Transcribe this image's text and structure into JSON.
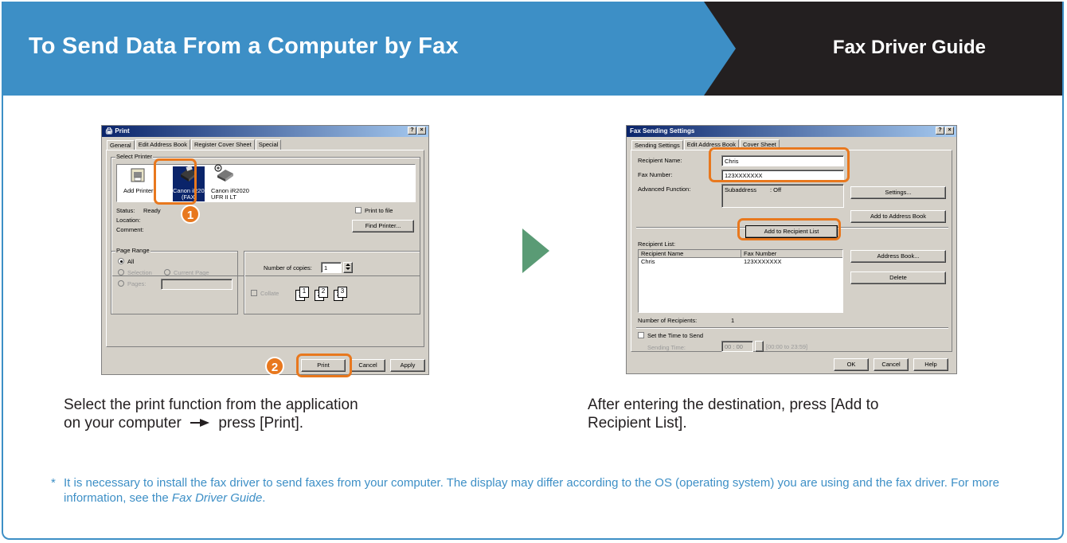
{
  "header": {
    "title": "To Send Data From a Computer by Fax",
    "guide": "Fax Driver Guide"
  },
  "colors": {
    "accent_blue": "#3d8fc6",
    "dark": "#231f20",
    "highlight_orange": "#e8781e",
    "arrow_green": "#5a9b75"
  },
  "print_dialog": {
    "title": "Print",
    "help_btn": "?",
    "close_btn": "×",
    "tabs": [
      "General",
      "Edit Address Book",
      "Register Cover Sheet",
      "Special"
    ],
    "select_printer_label": "Select Printer",
    "printers": [
      {
        "name": "Add Printer",
        "icon": "add-printer-icon"
      },
      {
        "name_line1": "Canon iR2020",
        "name_line2": "(FAX)",
        "icon": "fax-printer-icon"
      },
      {
        "name_line1": "Canon iR2020",
        "name_line2": "UFR II LT",
        "icon": "printer-icon"
      }
    ],
    "status_label": "Status:",
    "status_value": "Ready",
    "location_label": "Location:",
    "comment_label": "Comment:",
    "print_to_file": "Print to file",
    "find_printer": "Find Printer...",
    "page_range_label": "Page Range",
    "range_all": "All",
    "range_selection": "Selection",
    "range_current": "Current Page",
    "range_pages": "Pages:",
    "copies_label": "Number of copies:",
    "copies_value": "1",
    "collate": "Collate",
    "collate_icons": [
      "1",
      "1",
      "2",
      "2",
      "3",
      "3"
    ],
    "print_btn": "Print",
    "cancel_btn": "Cancel",
    "apply_btn": "Apply",
    "step1": "1",
    "step2": "2"
  },
  "fax_dialog": {
    "title": "Fax Sending Settings",
    "help_btn": "?",
    "close_btn": "×",
    "tabs": [
      "Sending Settings",
      "Edit Address Book",
      "Cover Sheet"
    ],
    "recipient_name_label": "Recipient Name:",
    "recipient_name_value": "Chris",
    "fax_number_label": "Fax Number:",
    "fax_number_value": "123XXXXXXX",
    "advanced_label": "Advanced Function:",
    "advanced_col1": "Subaddress",
    "advanced_col2": ": Off",
    "settings_btn": "Settings...",
    "add_address_book_btn": "Add to Address Book",
    "add_recipient_btn": "Add to Recipient List",
    "recipient_list_label": "Recipient List:",
    "list_headers": [
      "Recipient Name",
      "Fax Number"
    ],
    "list_rows": [
      {
        "name": "Chris",
        "fax": "123XXXXXXX"
      }
    ],
    "address_book_btn": "Address Book...",
    "delete_btn": "Delete",
    "num_recipients_label": "Number of Recipients:",
    "num_recipients_value": "1",
    "set_time_label": "Set the Time to Send",
    "sending_time_label": "Sending Time:",
    "sending_time_value": "00 : 00",
    "time_range": "[00:00 to 23:59]",
    "ok_btn": "OK",
    "cancel_btn": "Cancel",
    "help_text_btn": "Help"
  },
  "captions": {
    "left_line1": "Select the print function from the application",
    "left_line2_a": "on your computer",
    "left_line2_b": "press [Print].",
    "right_line1": "After entering the destination, press [Add to",
    "right_line2": "Recipient List]."
  },
  "note": {
    "star": "*",
    "text_a": "It is necessary to install the fax driver to send faxes from your computer. The display may differ according to the OS (operating system) you are using and the fax driver. For more information, see the ",
    "text_em": "Fax Driver Guide",
    "text_b": "."
  }
}
